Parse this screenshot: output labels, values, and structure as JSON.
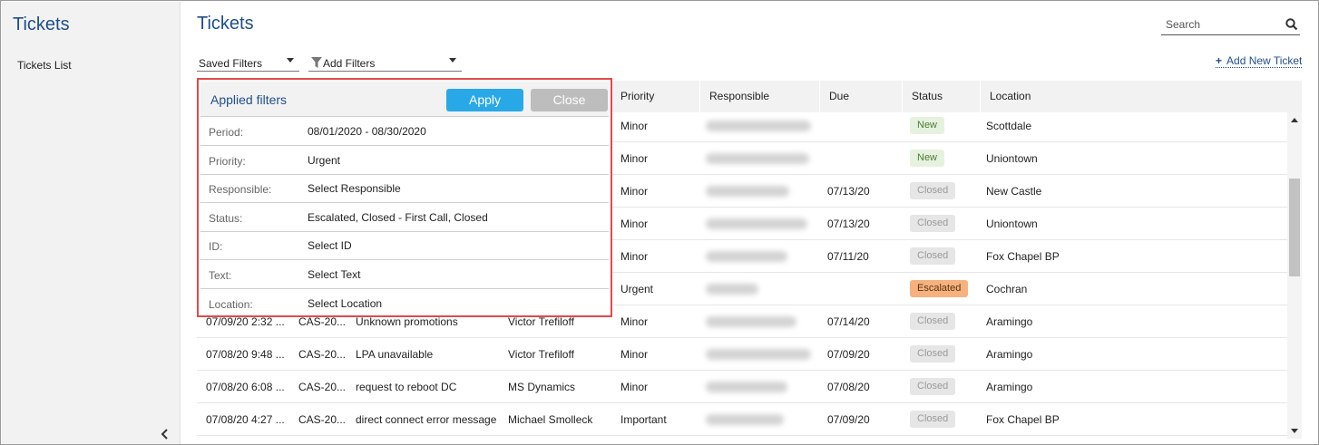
{
  "sidebar": {
    "title": "Tickets",
    "items": [
      {
        "label": "Tickets List"
      }
    ]
  },
  "header": {
    "title": "Tickets",
    "search_placeholder": "Search",
    "saved_filters": "Saved Filters",
    "add_filters": "Add Filters",
    "add_ticket": "Add New Ticket"
  },
  "table": {
    "columns": [
      "Priority",
      "Responsible",
      "Due",
      "Status",
      "Location"
    ],
    "rows": [
      {
        "created": "",
        "id": "",
        "title": "",
        "owner": "",
        "priority": "Minor",
        "due": "",
        "status": "New",
        "location": "Scottdale"
      },
      {
        "created": "",
        "id": "",
        "title": "",
        "owner": "",
        "priority": "Minor",
        "due": "",
        "status": "New",
        "location": "Uniontown"
      },
      {
        "created": "",
        "id": "",
        "title": "",
        "owner": "",
        "priority": "Minor",
        "due": "07/13/20",
        "status": "Closed",
        "location": "New Castle"
      },
      {
        "created": "",
        "id": "",
        "title": "",
        "owner": "",
        "priority": "Minor",
        "due": "07/13/20",
        "status": "Closed",
        "location": "Uniontown"
      },
      {
        "created": "",
        "id": "",
        "title": "",
        "owner": "",
        "priority": "Minor",
        "due": "07/11/20",
        "status": "Closed",
        "location": "Fox Chapel BP"
      },
      {
        "created": "",
        "id": "",
        "title": "",
        "owner": "",
        "priority": "Urgent",
        "due": "",
        "status": "Escalated",
        "location": "Cochran"
      },
      {
        "created": "07/09/20 2:32 ...",
        "id": "CAS-20...",
        "title": "Unknown promotions",
        "owner": "Victor Trefiloff",
        "priority": "Minor",
        "due": "07/14/20",
        "status": "Closed",
        "location": "Aramingo"
      },
      {
        "created": "07/08/20 9:48 ...",
        "id": "CAS-20...",
        "title": "LPA unavailable",
        "owner": "Victor Trefiloff",
        "priority": "Minor",
        "due": "07/09/20",
        "status": "Closed",
        "location": "Aramingo"
      },
      {
        "created": "07/08/20 6:08 ...",
        "id": "CAS-20...",
        "title": "request to reboot DC",
        "owner": "MS Dynamics",
        "priority": "Minor",
        "due": "07/08/20",
        "status": "Closed",
        "location": "Aramingo"
      },
      {
        "created": "07/08/20 4:27 ...",
        "id": "CAS-20...",
        "title": "direct connect error message",
        "owner": "Michael Smolleck",
        "priority": "Important",
        "due": "07/09/20",
        "status": "Closed",
        "location": "Fox Chapel BP"
      }
    ]
  },
  "filters_panel": {
    "title": "Applied filters",
    "apply_label": "Apply",
    "close_label": "Close",
    "rows": [
      {
        "label": "Period:",
        "value": "08/01/2020 - 08/30/2020"
      },
      {
        "label": "Priority:",
        "value": "Urgent"
      },
      {
        "label": "Responsible:",
        "value": "Select Responsible"
      },
      {
        "label": "Status:",
        "value": "Escalated, Closed - First Call, Closed"
      },
      {
        "label": "ID:",
        "value": "Select ID"
      },
      {
        "label": "Text:",
        "value": "Select Text"
      },
      {
        "label": "Location:",
        "value": "Select Location"
      }
    ]
  },
  "icons": {
    "search": "search-icon",
    "funnel": "filter-icon",
    "plus": "plus-icon",
    "collapse": "chevron-left-icon"
  },
  "colors": {
    "accent": "#1f4e8c",
    "apply": "#29a8e8",
    "close": "#bdbdbd",
    "panel_border": "#e04b4b",
    "escalated": "#f6b27e",
    "new": "#e6f2dd",
    "closed": "#e6e6e6"
  }
}
